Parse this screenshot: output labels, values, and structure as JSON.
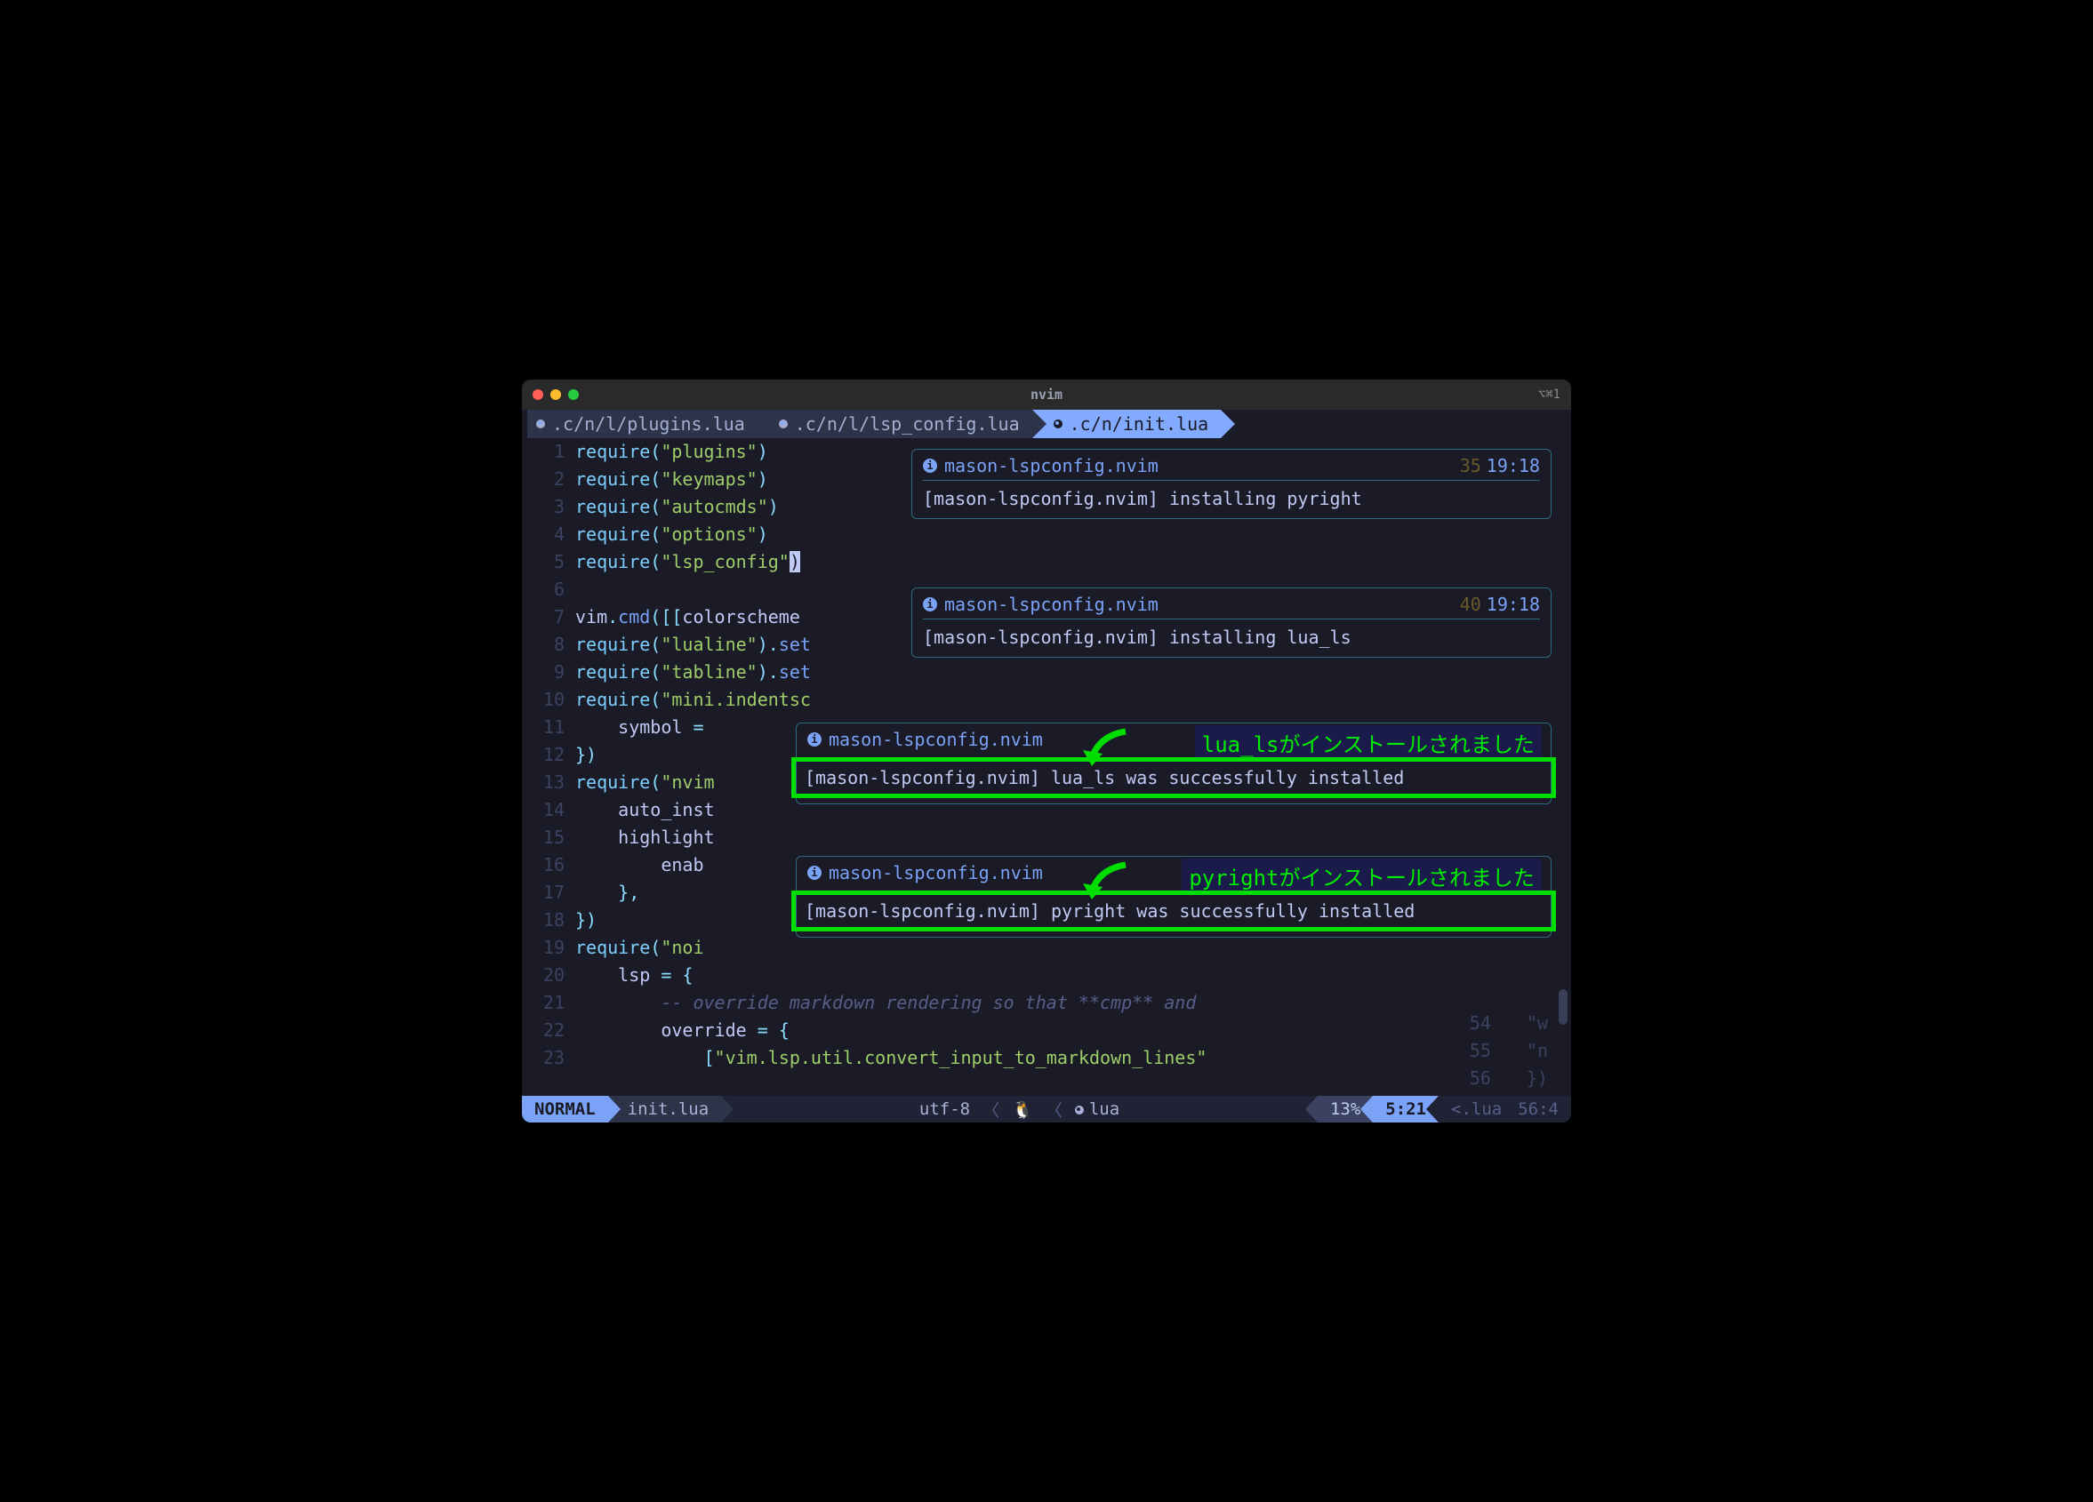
{
  "window": {
    "title": "nvim",
    "right_hint": "⌥⌘1"
  },
  "tabs": [
    {
      "label": ".c/n/l/plugins.lua",
      "active": false
    },
    {
      "label": ".c/n/l/lsp_config.lua",
      "active": false
    },
    {
      "label": ".c/n/init.lua",
      "active": true
    }
  ],
  "code": {
    "lines": [
      {
        "n": 1,
        "tokens": [
          [
            "kw",
            "require"
          ],
          [
            "paren",
            "("
          ],
          [
            "str",
            "\"plugins\""
          ],
          [
            "paren",
            ")"
          ]
        ]
      },
      {
        "n": 2,
        "tokens": [
          [
            "kw",
            "require"
          ],
          [
            "paren",
            "("
          ],
          [
            "str",
            "\"keymaps\""
          ],
          [
            "paren",
            ")"
          ]
        ]
      },
      {
        "n": 3,
        "tokens": [
          [
            "kw",
            "require"
          ],
          [
            "paren",
            "("
          ],
          [
            "str",
            "\"autocmds\""
          ],
          [
            "paren",
            ")"
          ]
        ]
      },
      {
        "n": 4,
        "tokens": [
          [
            "kw",
            "require"
          ],
          [
            "paren",
            "("
          ],
          [
            "str",
            "\"options\""
          ],
          [
            "paren",
            ")"
          ]
        ]
      },
      {
        "n": 5,
        "tokens": [
          [
            "kw",
            "require"
          ],
          [
            "paren",
            "("
          ],
          [
            "str",
            "\"lsp_config\""
          ],
          [
            "cursor",
            ")"
          ]
        ]
      },
      {
        "n": 6,
        "tokens": []
      },
      {
        "n": 7,
        "tokens": [
          [
            "var",
            "vim"
          ],
          [
            "paren",
            "."
          ],
          [
            "fn",
            "cmd"
          ],
          [
            "paren",
            "([["
          ],
          [
            "var",
            "colorscheme "
          ]
        ]
      },
      {
        "n": 8,
        "tokens": [
          [
            "kw",
            "require"
          ],
          [
            "paren",
            "("
          ],
          [
            "str",
            "\"lualine\""
          ],
          [
            "paren",
            ")."
          ],
          [
            "fn",
            "set"
          ]
        ]
      },
      {
        "n": 9,
        "tokens": [
          [
            "kw",
            "require"
          ],
          [
            "paren",
            "("
          ],
          [
            "str",
            "\"tabline\""
          ],
          [
            "paren",
            ")."
          ],
          [
            "fn",
            "set"
          ]
        ]
      },
      {
        "n": 10,
        "tokens": [
          [
            "kw",
            "require"
          ],
          [
            "paren",
            "("
          ],
          [
            "str",
            "\"mini.indentsc"
          ]
        ]
      },
      {
        "n": 11,
        "tokens": [
          [
            "var",
            "    symbol "
          ],
          [
            "paren",
            "="
          ]
        ]
      },
      {
        "n": 12,
        "tokens": [
          [
            "paren",
            "})"
          ]
        ]
      },
      {
        "n": 13,
        "tokens": [
          [
            "kw",
            "require"
          ],
          [
            "paren",
            "("
          ],
          [
            "str",
            "\"nvim"
          ]
        ]
      },
      {
        "n": 14,
        "tokens": [
          [
            "var",
            "    auto_inst"
          ]
        ]
      },
      {
        "n": 15,
        "tokens": [
          [
            "var",
            "    highlight"
          ]
        ]
      },
      {
        "n": 16,
        "tokens": [
          [
            "var",
            "        enab"
          ]
        ]
      },
      {
        "n": 17,
        "tokens": [
          [
            "paren",
            "    },"
          ]
        ]
      },
      {
        "n": 18,
        "tokens": [
          [
            "paren",
            "})"
          ]
        ]
      },
      {
        "n": 19,
        "tokens": [
          [
            "kw",
            "require"
          ],
          [
            "paren",
            "("
          ],
          [
            "str",
            "\"noi"
          ]
        ]
      },
      {
        "n": 20,
        "tokens": [
          [
            "var",
            "    lsp "
          ],
          [
            "paren",
            "= {"
          ]
        ]
      },
      {
        "n": 21,
        "tokens": [
          [
            "comment",
            "        -- override markdown rendering so that **cmp** and"
          ]
        ]
      },
      {
        "n": 22,
        "tokens": [
          [
            "var",
            "        override "
          ],
          [
            "paren",
            "= {"
          ]
        ]
      },
      {
        "n": 23,
        "tokens": [
          [
            "var",
            "            "
          ],
          [
            "paren",
            "["
          ],
          [
            "str",
            "\"vim.lsp.util.convert_input_to_markdown_lines\""
          ]
        ]
      }
    ]
  },
  "notifications": [
    {
      "source": "mason-lspconfig.nvim",
      "count": "35",
      "time": "19:18",
      "body": "[mason-lspconfig.nvim] installing pyright"
    },
    {
      "source": "mason-lspconfig.nvim",
      "count": "40",
      "time": "19:18",
      "body": "[mason-lspconfig.nvim] installing lua_ls"
    },
    {
      "source": "mason-lspconfig.nvim",
      "body": "[mason-lspconfig.nvim] lua_ls was successfully installed",
      "callout": "lua_lsがインストールされました"
    },
    {
      "source": "mason-lspconfig.nvim",
      "body": "[mason-lspconfig.nvim] pyright was successfully installed",
      "callout": "pyrightがインストールされました"
    }
  ],
  "right_split": [
    {
      "lno": "54",
      "lc": "\"w"
    },
    {
      "lno": "55",
      "lc": "\"n"
    },
    {
      "lno": "56",
      "lc": "})"
    }
  ],
  "right_split_dim_tail": "})",
  "statusline": {
    "mode": "NORMAL",
    "file": "init.lua",
    "encoding": "utf-8",
    "os_icon": "🐧",
    "filetype": "lua",
    "percent": "13%",
    "position": "5:21",
    "alt_file": "<.lua",
    "alt_pos": "56:4"
  }
}
